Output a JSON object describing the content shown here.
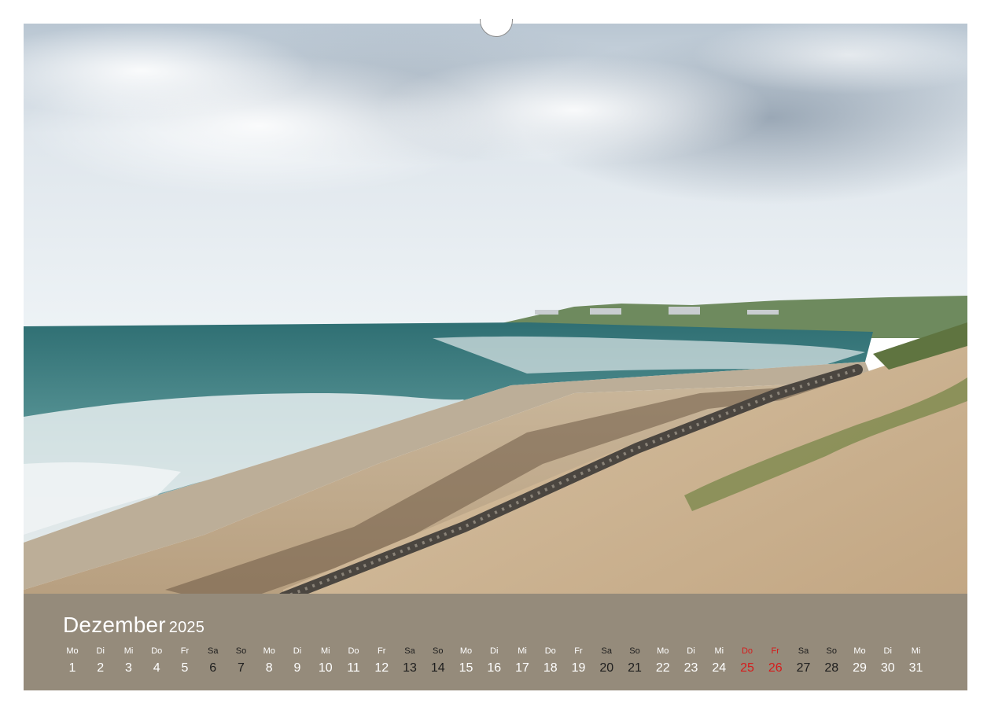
{
  "calendar": {
    "month": "Dezember",
    "year": "2025",
    "days": [
      {
        "wd": "Mo",
        "n": "1",
        "style": "normal"
      },
      {
        "wd": "Di",
        "n": "2",
        "style": "normal"
      },
      {
        "wd": "Mi",
        "n": "3",
        "style": "normal"
      },
      {
        "wd": "Do",
        "n": "4",
        "style": "normal"
      },
      {
        "wd": "Fr",
        "n": "5",
        "style": "normal"
      },
      {
        "wd": "Sa",
        "n": "6",
        "style": "dark"
      },
      {
        "wd": "So",
        "n": "7",
        "style": "dark"
      },
      {
        "wd": "Mo",
        "n": "8",
        "style": "normal"
      },
      {
        "wd": "Di",
        "n": "9",
        "style": "normal"
      },
      {
        "wd": "Mi",
        "n": "10",
        "style": "normal"
      },
      {
        "wd": "Do",
        "n": "11",
        "style": "normal"
      },
      {
        "wd": "Fr",
        "n": "12",
        "style": "normal"
      },
      {
        "wd": "Sa",
        "n": "13",
        "style": "dark"
      },
      {
        "wd": "So",
        "n": "14",
        "style": "dark"
      },
      {
        "wd": "Mo",
        "n": "15",
        "style": "normal"
      },
      {
        "wd": "Di",
        "n": "16",
        "style": "normal"
      },
      {
        "wd": "Mi",
        "n": "17",
        "style": "normal"
      },
      {
        "wd": "Do",
        "n": "18",
        "style": "normal"
      },
      {
        "wd": "Fr",
        "n": "19",
        "style": "normal"
      },
      {
        "wd": "Sa",
        "n": "20",
        "style": "dark"
      },
      {
        "wd": "So",
        "n": "21",
        "style": "dark"
      },
      {
        "wd": "Mo",
        "n": "22",
        "style": "normal"
      },
      {
        "wd": "Di",
        "n": "23",
        "style": "normal"
      },
      {
        "wd": "Mi",
        "n": "24",
        "style": "normal"
      },
      {
        "wd": "Do",
        "n": "25",
        "style": "hol"
      },
      {
        "wd": "Fr",
        "n": "26",
        "style": "hol"
      },
      {
        "wd": "Sa",
        "n": "27",
        "style": "dark"
      },
      {
        "wd": "So",
        "n": "28",
        "style": "dark"
      },
      {
        "wd": "Mo",
        "n": "29",
        "style": "normal"
      },
      {
        "wd": "Di",
        "n": "30",
        "style": "normal"
      },
      {
        "wd": "Mi",
        "n": "31",
        "style": "normal"
      }
    ]
  },
  "colors": {
    "holiday": "#d51c1c",
    "weekend": "#1e1e1e",
    "weekday": "#ffffff"
  },
  "photo": {
    "subject": "beach-with-dunes-and-fence-icon"
  }
}
